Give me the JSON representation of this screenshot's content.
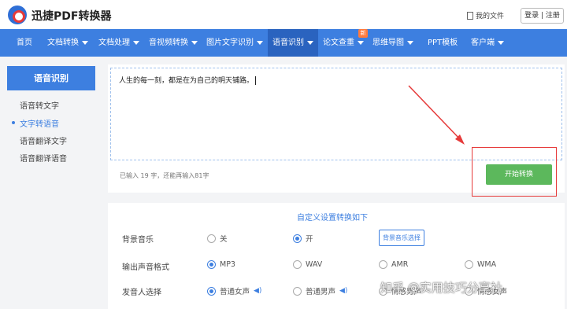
{
  "header": {
    "brand": "迅捷PDF转换器",
    "my_files": "我的文件",
    "login": "登录 | 注册"
  },
  "nav": {
    "items": [
      {
        "label": "首页",
        "caret": false
      },
      {
        "label": "文档转换",
        "caret": true
      },
      {
        "label": "文档处理",
        "caret": true
      },
      {
        "label": "音视频转换",
        "caret": true
      },
      {
        "label": "图片文字识别",
        "caret": true
      },
      {
        "label": "语音识别",
        "caret": true,
        "active": true
      },
      {
        "label": "论文查重",
        "caret": true
      },
      {
        "label": "思维导图",
        "caret": true
      },
      {
        "label": "PPT模板",
        "caret": false
      },
      {
        "label": "客户端",
        "caret": true
      }
    ],
    "badge": "新"
  },
  "sidebar": {
    "title": "语音识别",
    "items": [
      {
        "label": "语音转文字",
        "active": false
      },
      {
        "label": "文字转语音",
        "active": true
      },
      {
        "label": "语音翻译文字",
        "active": false
      },
      {
        "label": "语音翻译语音",
        "active": false
      }
    ]
  },
  "editor": {
    "text": "人生的每一刻，都是在为自己的明天铺路。",
    "counter": "已输入 19 字，还能再输入81字",
    "start_button": "开始转换"
  },
  "settings": {
    "title": "自定义设置转换如下",
    "background_music": {
      "label": "背景音乐",
      "off": "关",
      "on": "开",
      "selected": "开",
      "choose_button": "背景音乐选择"
    },
    "format": {
      "label": "输出声音格式",
      "options": [
        "MP3",
        "WAV",
        "AMR",
        "WMA"
      ],
      "selected": "MP3"
    },
    "voice": {
      "label": "发音人选择",
      "options": [
        "普通女声",
        "普通男声",
        "情感男声",
        "情感女声"
      ],
      "selected": "普通女声"
    }
  },
  "watermark": "知乎 @实用技巧分享社",
  "colors": {
    "nav_bg": "#3d7fe0",
    "nav_active": "#2a63bf",
    "start_button": "#5cb85c",
    "highlight_box": "#e63a3a",
    "badge": "#ff7a3d"
  }
}
